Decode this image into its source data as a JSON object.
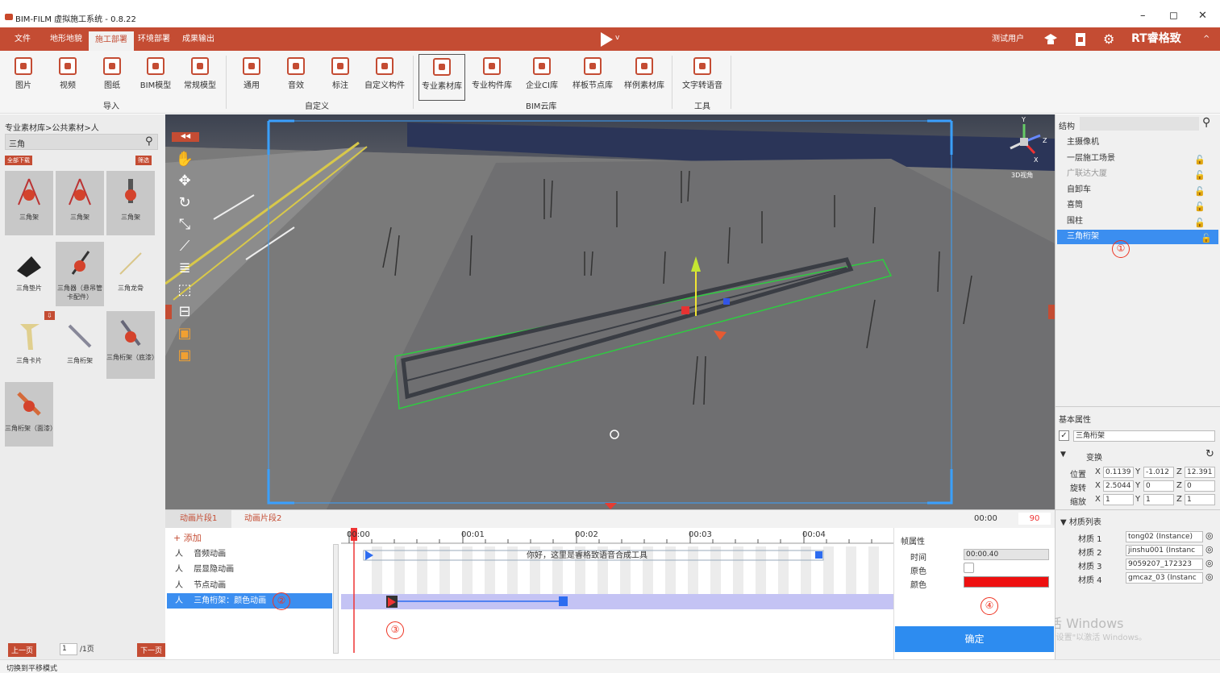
{
  "window": {
    "title": "BIM-FILM 虚拟施工系统 - 0.8.22",
    "minimize": "–",
    "maximize": "◻",
    "close": "✕"
  },
  "menu": {
    "items": [
      "文件",
      "地形地貌",
      "施工部署",
      "环境部署",
      "成果输出"
    ],
    "active": "施工部署",
    "user": "测试用户",
    "brand": "RT睿格致",
    "brand_caret": "^",
    "play_caret": "v"
  },
  "toolbar": {
    "tools": [
      "图片",
      "视频",
      "图纸",
      "BIM模型",
      "常规模型",
      "通用",
      "音效",
      "标注",
      "自定义构件",
      "专业素材库",
      "专业构件库",
      "企业CI库",
      "样板节点库",
      "样例素材库",
      "文字转语音"
    ],
    "selected": "专业素材库",
    "groups": [
      "导入",
      "自定义",
      "BIM云库",
      "工具"
    ]
  },
  "left": {
    "breadcrumb": "专业素材库>公共素材>人",
    "search_value": "三角",
    "download_all": "全部下载",
    "filter": "筛选",
    "assets": [
      "三角架",
      "三角架",
      "三角架",
      "三角垫片",
      "三角器（悬吊管卡配件）",
      "三角龙骨",
      "三角卡片",
      "三角桁架",
      "三角桁架（底漆）",
      "三角桁架（面漆）"
    ],
    "prev": "上一页",
    "page": "1",
    "total": "/1页",
    "next": "下一页"
  },
  "status": "切换到平移模式",
  "viewport": {
    "gizmo_label": "3D视角",
    "axis_y": "Y",
    "axis_z": "Z",
    "axis_x": "X"
  },
  "right": {
    "structure_title": "结构",
    "tree": [
      "主摄像机",
      "一层施工场景",
      "广联达大厦",
      "自卸车",
      "喜筒",
      "围柱",
      "三角桁架"
    ],
    "selected_index": 6,
    "basic_props": "基本属性",
    "object_name": "三角桁架",
    "transform": "变换",
    "position": {
      "label": "位置",
      "x": "0.1139",
      "y": "-1.012",
      "z": "12.391"
    },
    "rotation": {
      "label": "旋转",
      "x": "2.5044",
      "y": "0",
      "z": "0"
    },
    "scale": {
      "label": "缩放",
      "x": "1",
      "y": "1",
      "z": "1"
    },
    "materials_title": "材质列表",
    "materials": [
      {
        "label": "材质 1",
        "value": "tong02 (Instance)"
      },
      {
        "label": "材质 2",
        "value": "jinshu001 (Instanc"
      },
      {
        "label": "材质 3",
        "value": "9059207_172323"
      },
      {
        "label": "材质 4",
        "value": "gmcaz_03 (Instanc"
      }
    ],
    "watermark1": "激活 Windows",
    "watermark2": "转到\"设置\"以激活 Windows。"
  },
  "timeline": {
    "tabs": [
      "动画片段1",
      "动画片段2"
    ],
    "time": "00:00",
    "frames": "90",
    "add": "+ 添加",
    "tracks": [
      "音频动画",
      "层显隐动画",
      "节点动画",
      "三角桁架：颜色动画"
    ],
    "ticks": [
      "00:00",
      "00:01",
      "00:02",
      "00:03",
      "00:04"
    ],
    "audio_text": "你好，这里是睿格致语音合成工具",
    "frame_props": "帧属性",
    "time_label": "时间",
    "time_value": "00:00.40",
    "orig_color": "原色",
    "color_label": "颜色",
    "color_value": "#ee1010",
    "confirm": "确定",
    "markers": [
      "①",
      "②",
      "③",
      "④"
    ]
  }
}
